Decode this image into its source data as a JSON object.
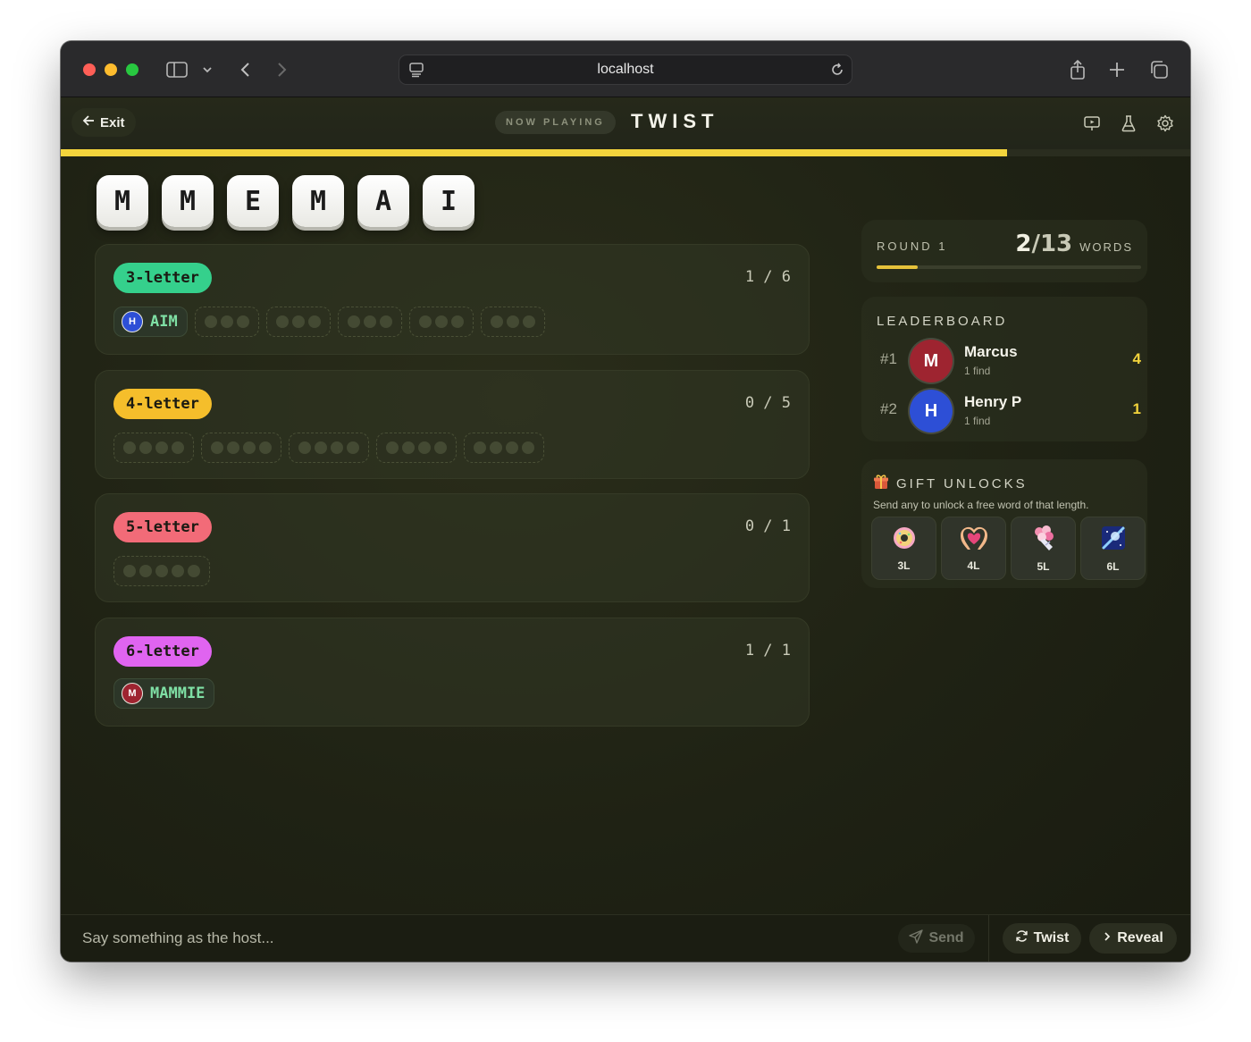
{
  "browser": {
    "url": "localhost"
  },
  "topbar": {
    "exit_label": "Exit",
    "now_playing": "NOW PLAYING",
    "title": "TWIST",
    "progress_fraction": 0.838
  },
  "letters": [
    "M",
    "M",
    "E",
    "M",
    "A",
    "I"
  ],
  "groups": [
    {
      "label": "3-letter",
      "count": "1 / 6",
      "color": "#35d08c",
      "found": [
        {
          "word": "AIM",
          "initial": "H",
          "color": "#2d4fd6"
        }
      ],
      "empty_slots": 5,
      "letters": 3
    },
    {
      "label": "4-letter",
      "count": "0 / 5",
      "color": "#f5be2b",
      "found": [],
      "empty_slots": 5,
      "letters": 4
    },
    {
      "label": "5-letter",
      "count": "0 / 1",
      "color": "#f26b78",
      "found": [],
      "empty_slots": 1,
      "letters": 5
    },
    {
      "label": "6-letter",
      "count": "1 / 1",
      "color": "#e064f0",
      "found": [
        {
          "word": "MAMMIE",
          "initial": "M",
          "color": "#9e2430"
        }
      ],
      "empty_slots": 0,
      "letters": 6
    }
  ],
  "round": {
    "label": "ROUND 1",
    "found": "2",
    "total": "/13",
    "words_label": "WORDS",
    "progress_fraction": 0.154
  },
  "leaderboard": {
    "title": "LEADERBOARD",
    "rows": [
      {
        "rank": "#1",
        "initial": "M",
        "name": "Marcus",
        "sub": "1 find",
        "score": "4",
        "color": "#9e2430"
      },
      {
        "rank": "#2",
        "initial": "H",
        "name": "Henry P",
        "sub": "1 find",
        "score": "1",
        "color": "#2d4fd6"
      }
    ]
  },
  "gifts": {
    "title": "GIFT UNLOCKS",
    "subtitle": "Send any to unlock a free word of that length.",
    "items": [
      {
        "label": "3L",
        "icon": "donut-icon"
      },
      {
        "label": "4L",
        "icon": "heart-hands-icon"
      },
      {
        "label": "5L",
        "icon": "bouquet-icon"
      },
      {
        "label": "6L",
        "icon": "galaxy-icon"
      }
    ]
  },
  "bottombar": {
    "chat_placeholder": "Say something as the host...",
    "send_label": "Send",
    "twist_label": "Twist",
    "reveal_label": "Reveal"
  }
}
